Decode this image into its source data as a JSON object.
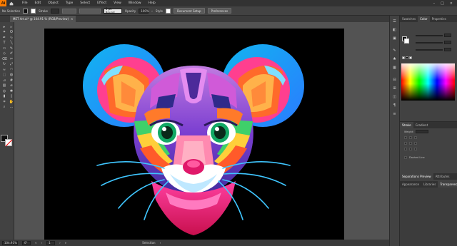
{
  "menubar": {
    "logo": "Ai",
    "items": [
      "File",
      "Edit",
      "Object",
      "Type",
      "Select",
      "Effect",
      "View",
      "Window",
      "Help"
    ]
  },
  "controlbar": {
    "selection_label": "No Selection",
    "stroke_label": "Stroke",
    "stroke_style": "5 pt. Round",
    "opacity_label": "Opacity",
    "opacity_value": "100%",
    "style_label": "Style",
    "doc_setup_label": "Document Setup",
    "preferences_label": "Preferences"
  },
  "document": {
    "tab_title": "MET Art.ai* @ 104.91 % (RGB/Preview)",
    "close": "×"
  },
  "statusbar": {
    "zoom": "104.91%",
    "rotation": "0°",
    "artboard_nav": "1",
    "tool_name": "Selection"
  },
  "panels": {
    "top_tabs": [
      "Swatches",
      "Color",
      "Properties"
    ],
    "active_top_tab": "Color",
    "stroke_tabs": [
      "Stroke",
      "Gradient"
    ],
    "stroke_weight_label": "Weight:",
    "dashed_line_label": "Dashed Line",
    "bottom_tabs_1": [
      "Separations Preview",
      "Attributes"
    ],
    "bottom_tabs_2": [
      "Appearance",
      "Libraries",
      "Transparency"
    ],
    "active_bottom_tab": "Transparency"
  },
  "colors": {
    "brand_orange": "#ff7c00",
    "ui_dark": "#323232",
    "ui_mid": "#424242",
    "canvas_bg": "#535353",
    "artboard": "#000000"
  },
  "tools": [
    "selection-tool",
    "direct-selection-tool",
    "magic-wand-tool",
    "lasso-tool",
    "pen-tool",
    "curvature-tool",
    "type-tool",
    "line-tool",
    "rectangle-tool",
    "paintbrush-tool",
    "shaper-tool",
    "pencil-tool",
    "eraser-tool",
    "scissors-tool",
    "rotate-tool",
    "scale-tool",
    "width-tool",
    "warp-tool",
    "free-transform-tool",
    "shape-builder-tool",
    "perspective-grid-tool",
    "mesh-tool",
    "gradient-tool",
    "eyedropper-tool",
    "blend-tool",
    "symbol-sprayer-tool",
    "column-graph-tool",
    "artboard-tool",
    "slice-tool",
    "hand-tool",
    "zoom-tool",
    "edit-toolbar"
  ]
}
